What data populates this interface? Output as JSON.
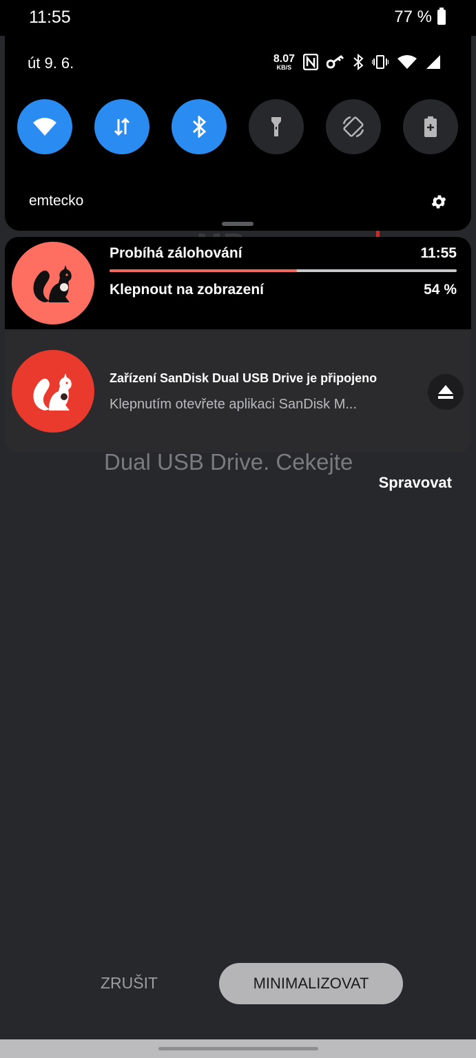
{
  "status_bar": {
    "time": "11:55",
    "battery": "77 %"
  },
  "quick_settings": {
    "date": "út 9. 6.",
    "network_speed_value": "8.07",
    "network_speed_unit": "KB/S",
    "user": "emtecko",
    "tiles": [
      {
        "name": "wifi",
        "active": true
      },
      {
        "name": "mobile-data",
        "active": true
      },
      {
        "name": "bluetooth",
        "active": true
      },
      {
        "name": "flashlight",
        "active": false
      },
      {
        "name": "auto-rotate",
        "active": false
      },
      {
        "name": "battery-saver",
        "active": false
      }
    ]
  },
  "notifications": {
    "backup": {
      "title": "Probíhá zálohování",
      "time": "11:55",
      "subtitle": "Klepnout na zobrazení",
      "percent_label": "54 %",
      "progress": 0.54
    },
    "usb": {
      "title": "Zařízení SanDisk Dual USB Drive je připojeno",
      "text": "Klepnutím otevřete aplikaci SanDisk M..."
    },
    "manage_label": "Spravovat"
  },
  "background": {
    "text": "Dual USB Drive. Cekejte"
  },
  "buttons": {
    "cancel": "ZRUŠIT",
    "minimize": "MINIMALIZOVAT"
  },
  "colors": {
    "accent_blue": "#2a8cf0",
    "backup_icon": "#ff6f61",
    "usb_icon": "#ea3a2d",
    "progress": "#f26a5e"
  }
}
